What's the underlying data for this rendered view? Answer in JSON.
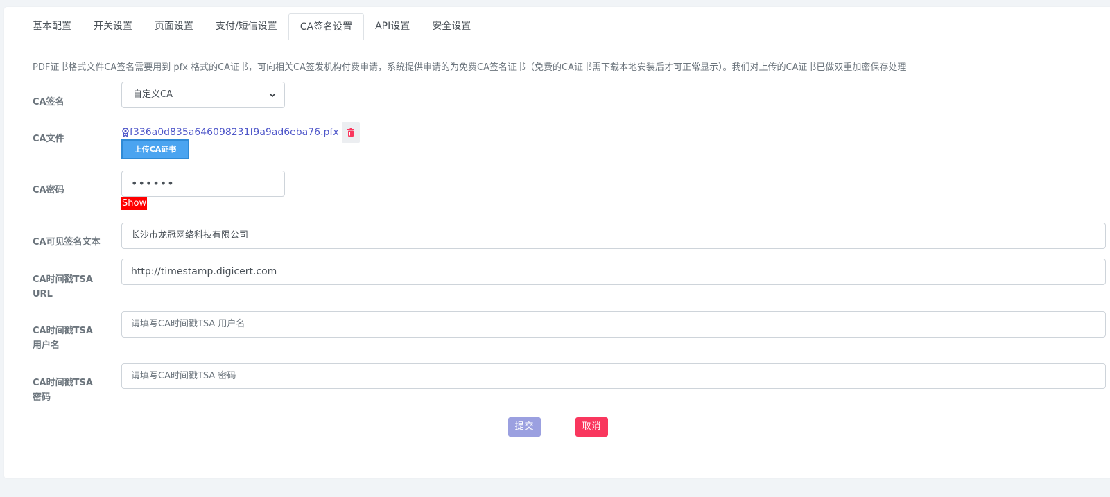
{
  "tabs": [
    {
      "label": "基本配置",
      "active": false
    },
    {
      "label": "开关设置",
      "active": false
    },
    {
      "label": "页面设置",
      "active": false
    },
    {
      "label": "支付/短信设置",
      "active": false
    },
    {
      "label": "CA签名设置",
      "active": true
    },
    {
      "label": "API设置",
      "active": false
    },
    {
      "label": "安全设置",
      "active": false
    }
  ],
  "description": "PDF证书格式文件CA签名需要用到 pfx 格式的CA证书，可向相关CA签发机构付费申请，系统提供申请的为免费CA签名证书（免费的CA证书需下载本地安装后才可正常显示）。我们对上传的CA证书已做双重加密保存处理",
  "form": {
    "ca_sign": {
      "label": "CA签名",
      "value": "自定义CA"
    },
    "ca_file": {
      "label": "CA文件",
      "filename": "f336a0d835a646098231f9a9ad6eba76.pfx",
      "upload_label": "上传CA证书"
    },
    "ca_password": {
      "label": "CA密码",
      "value": "••••••",
      "show_label": "Show"
    },
    "ca_visible_text": {
      "label": "CA可见签名文本",
      "value": "长沙市龙冠网络科技有限公司"
    },
    "tsa_url": {
      "label_line1": "CA时间戳TSA",
      "label_line2": "URL",
      "value": "http://timestamp.digicert.com"
    },
    "tsa_username": {
      "label_line1": "CA时间戳TSA",
      "label_line2": "用户名",
      "placeholder": "请填写CA时间戳TSA 用户名"
    },
    "tsa_password": {
      "label_line1": "CA时间戳TSA",
      "label_line2": "密码",
      "placeholder": "请填写CA时间戳TSA 密码"
    }
  },
  "actions": {
    "submit_label": "提交",
    "cancel_label": "取消"
  },
  "colors": {
    "primary": "#9ba0e0",
    "danger": "#f9375e",
    "link": "#4e56c9",
    "upload": "#4ba4f0",
    "show": "#ff0000"
  }
}
